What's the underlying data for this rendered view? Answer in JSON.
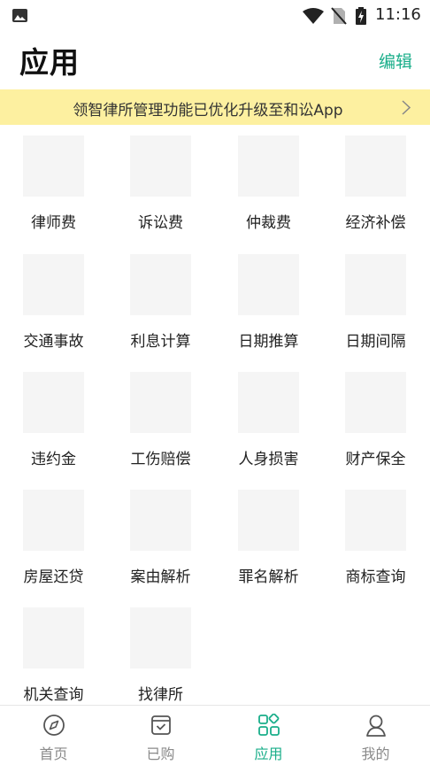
{
  "status_bar": {
    "time": "11:16"
  },
  "header": {
    "title": "应用",
    "edit_label": "编辑"
  },
  "banner": {
    "text": "领智律所管理功能已优化升级至和讼App"
  },
  "apps": [
    {
      "label": "律师费"
    },
    {
      "label": "诉讼费"
    },
    {
      "label": "仲裁费"
    },
    {
      "label": "经济补偿"
    },
    {
      "label": "交通事故"
    },
    {
      "label": "利息计算"
    },
    {
      "label": "日期推算"
    },
    {
      "label": "日期间隔"
    },
    {
      "label": "违约金"
    },
    {
      "label": "工伤赔偿"
    },
    {
      "label": "人身损害"
    },
    {
      "label": "财产保全"
    },
    {
      "label": "房屋还贷"
    },
    {
      "label": "案由解析"
    },
    {
      "label": "罪名解析"
    },
    {
      "label": "商标查询"
    },
    {
      "label": "机关查询"
    },
    {
      "label": "找律所"
    }
  ],
  "tabbar": {
    "active_color": "#1aae8a",
    "tabs": [
      {
        "label": "首页",
        "icon": "compass-icon"
      },
      {
        "label": "已购",
        "icon": "purchased-box-icon"
      },
      {
        "label": "应用",
        "icon": "apps-grid-icon",
        "active": true
      },
      {
        "label": "我的",
        "icon": "user-icon"
      }
    ]
  }
}
